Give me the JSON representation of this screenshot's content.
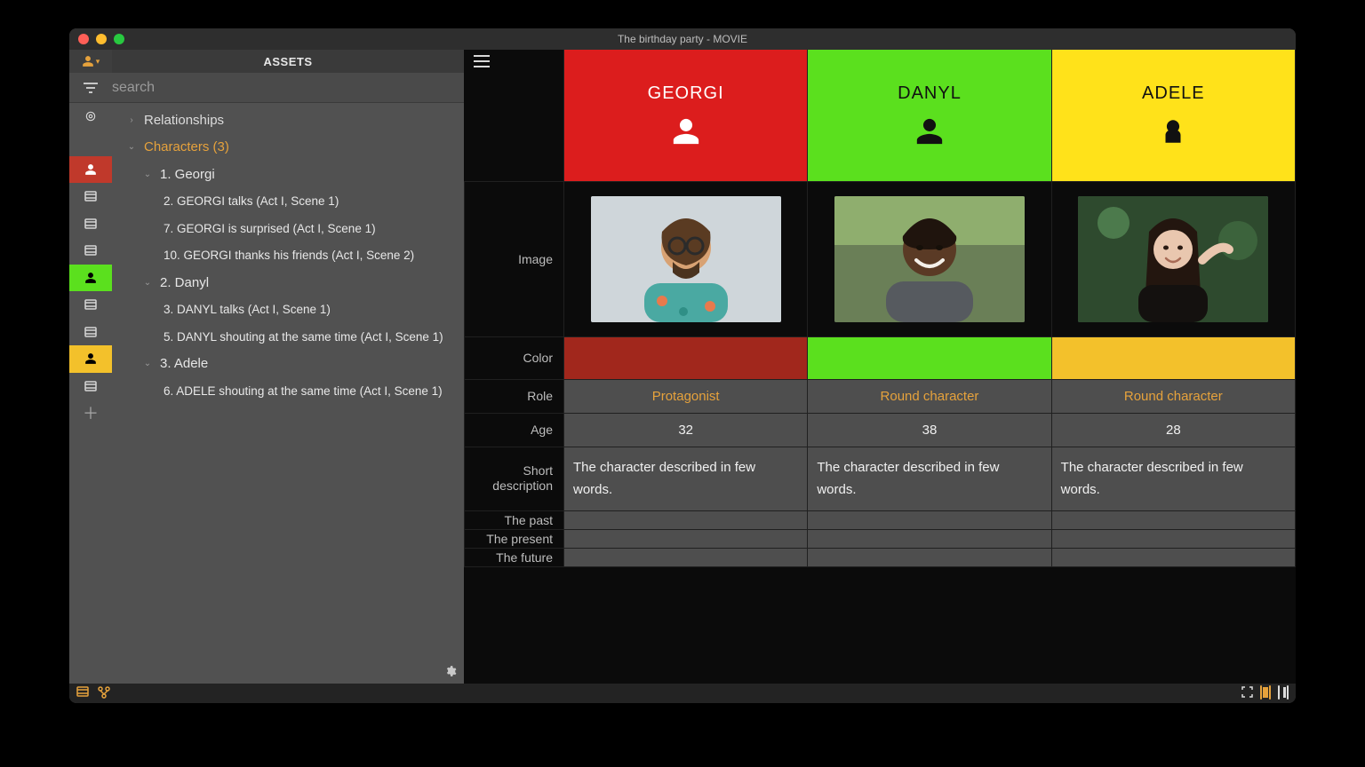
{
  "window": {
    "title": "The birthday party - MOVIE"
  },
  "sidebar": {
    "header": "ASSETS",
    "search_placeholder": "search",
    "sections": {
      "relationships": "Relationships",
      "characters": "Characters (3)"
    },
    "characters": [
      {
        "label": "1. Georgi",
        "scenes": [
          "2. GEORGI talks (Act I, Scene 1)",
          "7. GEORGI is surprised (Act I, Scene 1)",
          "10. GEORGI thanks his friends (Act I, Scene 2)"
        ]
      },
      {
        "label": "2. Danyl",
        "scenes": [
          "3. DANYL talks (Act I, Scene 1)",
          "5. DANYL shouting at the same time (Act I, Scene 1)"
        ]
      },
      {
        "label": "3. Adele",
        "scenes": [
          "6. ADELE shouting at the same time (Act I, Scene 1)"
        ]
      }
    ]
  },
  "comparison": {
    "row_labels": {
      "image": "Image",
      "color": "Color",
      "role": "Role",
      "age": "Age",
      "short_desc": "Short description",
      "past": "The past",
      "present": "The present",
      "future": "The future"
    },
    "columns": [
      {
        "name": "GEORGI",
        "header_color": "#dc1d1d",
        "color": "#a1271c",
        "role": "Protagonist",
        "age": "32",
        "short_desc": "The character described in few words.",
        "past": "",
        "present": "",
        "future": ""
      },
      {
        "name": "DANYL",
        "header_color": "#5be01e",
        "color": "#5be01e",
        "role": "Round character",
        "age": "38",
        "short_desc": "The character described in few words.",
        "past": "",
        "present": "",
        "future": ""
      },
      {
        "name": "ADELE",
        "header_color": "#ffe21a",
        "color": "#f3c12b",
        "role": "Round character",
        "age": "28",
        "short_desc": "The character described in few words.",
        "past": "",
        "present": "",
        "future": ""
      }
    ]
  }
}
